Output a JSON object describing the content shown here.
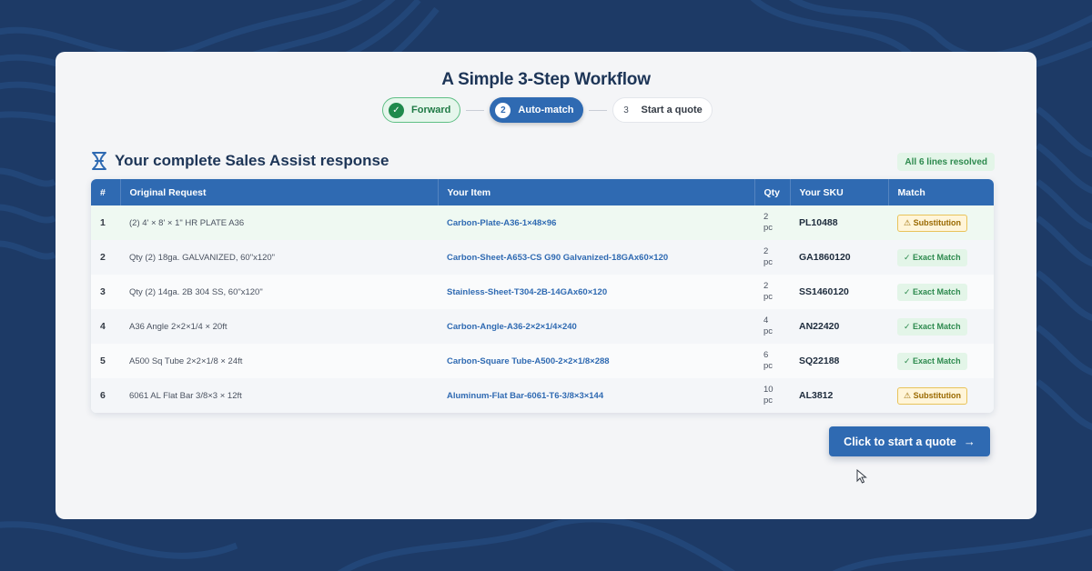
{
  "page_title": "A Simple 3-Step Workflow",
  "steps": [
    {
      "number": "✓",
      "label": "Forward",
      "state": "done"
    },
    {
      "number": "2",
      "label": "Auto-match",
      "state": "active"
    },
    {
      "number": "3",
      "label": "Start a quote",
      "state": "todo"
    }
  ],
  "section": {
    "title": "Your complete Sales Assist response",
    "status_badge": "All 6 lines resolved"
  },
  "table": {
    "columns": [
      "#",
      "Original Request",
      "Your Item",
      "Qty",
      "Your SKU",
      "Match"
    ],
    "rows": [
      {
        "num": "1",
        "request": "(2) 4' × 8' × 1\" HR PLATE A36",
        "item": "Carbon-Plate-A36-1×48×96",
        "qty": "2",
        "unit": "pc",
        "sku": "PL10488",
        "match": "⚠ Substitution",
        "match_type": "sub"
      },
      {
        "num": "2",
        "request": "Qty (2) 18ga. GALVANIZED, 60\"x120\"",
        "item": "Carbon-Sheet-A653-CS G90 Galvanized-18GAx60×120",
        "qty": "2",
        "unit": "pc",
        "sku": "GA1860120",
        "match": "✓ Exact Match",
        "match_type": "exact"
      },
      {
        "num": "3",
        "request": "Qty (2) 14ga. 2B 304 SS, 60\"x120\"",
        "item": "Stainless-Sheet-T304-2B-14GAx60×120",
        "qty": "2",
        "unit": "pc",
        "sku": "SS1460120",
        "match": "✓ Exact Match",
        "match_type": "exact"
      },
      {
        "num": "4",
        "request": "A36 Angle 2×2×1/4 × 20ft",
        "item": "Carbon-Angle-A36-2×2×1/4×240",
        "qty": "4",
        "unit": "pc",
        "sku": "AN22420",
        "match": "✓ Exact Match",
        "match_type": "exact"
      },
      {
        "num": "5",
        "request": "A500 Sq Tube 2×2×1/8 × 24ft",
        "item": "Carbon-Square Tube-A500-2×2×1/8×288",
        "qty": "6",
        "unit": "pc",
        "sku": "SQ22188",
        "match": "✓ Exact Match",
        "match_type": "exact"
      },
      {
        "num": "6",
        "request": "6061 AL Flat Bar 3/8×3 × 12ft",
        "item": "Aluminum-Flat Bar-6061-T6-3/8×3×144",
        "qty": "10",
        "unit": "pc",
        "sku": "AL3812",
        "match": "⚠ Substitution",
        "match_type": "sub"
      }
    ]
  },
  "cta": {
    "label": "Click to start a quote",
    "arrow": "→"
  },
  "colors": {
    "background": "#1d3a66",
    "accent": "#2f6ab2",
    "success": "#2d8a4e",
    "warning": "#9a6a00"
  },
  "icons": {
    "logo": "sales-assist-logo-icon",
    "check": "check-icon",
    "cursor": "mouse-pointer-icon"
  }
}
